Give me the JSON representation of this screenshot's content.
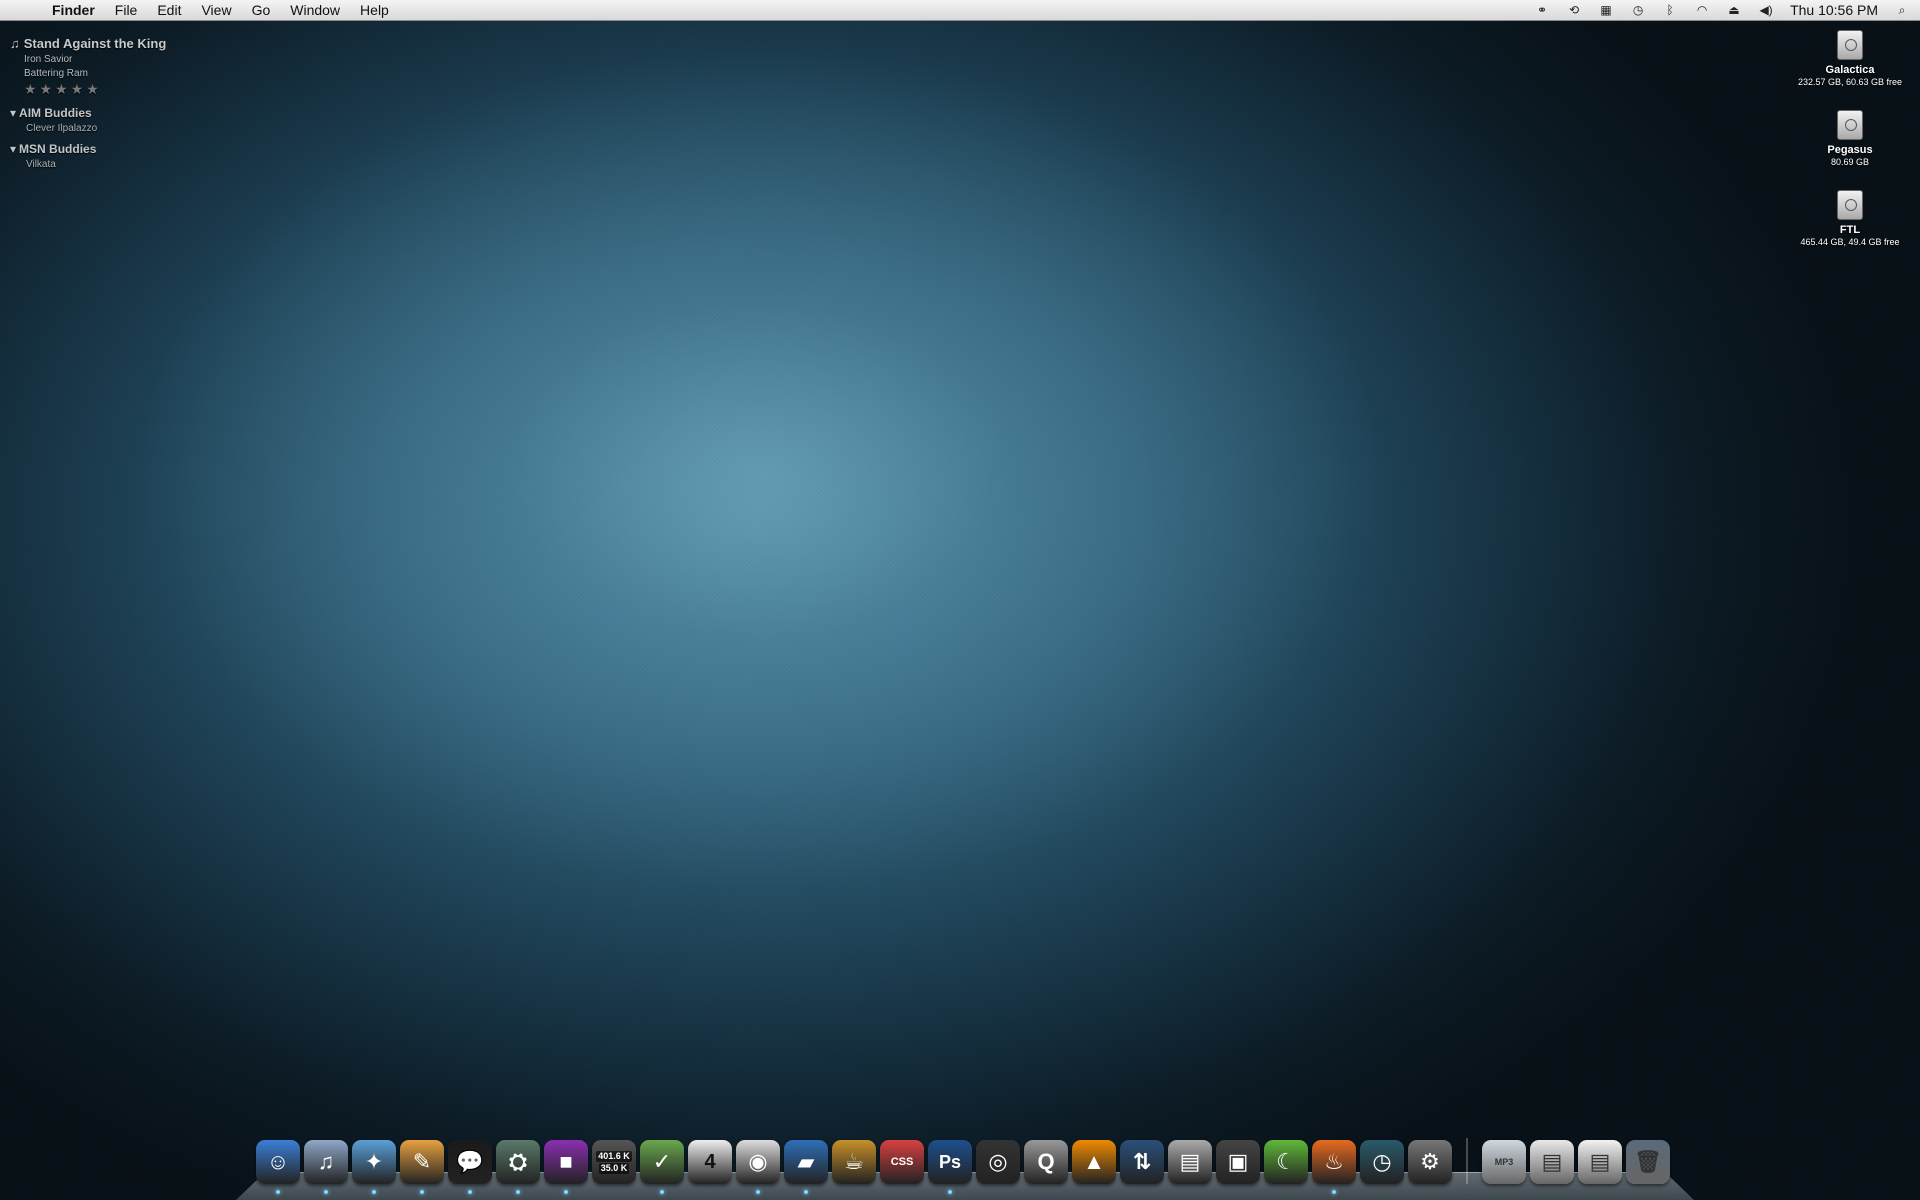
{
  "menubar": {
    "apple": "",
    "app_name": "Finder",
    "menus": [
      "File",
      "Edit",
      "View",
      "Go",
      "Window",
      "Help"
    ],
    "status_icons": [
      "binoculars-icon",
      "sync-icon",
      "spaces-icon",
      "time-machine-icon",
      "bluetooth-icon",
      "wifi-icon",
      "eject-icon",
      "volume-icon"
    ],
    "clock": "Thu 10:56 PM",
    "spotlight": "⌕"
  },
  "now_playing": {
    "title": "Stand Against the King",
    "artist": "Iron Savior",
    "album": "Battering Ram",
    "rating": "★★★★★",
    "rating_value": 0
  },
  "buddies": [
    {
      "group": "AIM Buddies",
      "members": [
        "Clever Ilpalazzo"
      ]
    },
    {
      "group": "MSN Buddies",
      "members": [
        "Vilkata"
      ]
    }
  ],
  "drives": [
    {
      "name": "Galactica",
      "info": "232.57 GB, 60.63 GB free"
    },
    {
      "name": "Pegasus",
      "info": "80.69 GB"
    },
    {
      "name": "FTL",
      "info": "465.44 GB, 49.4 GB free"
    }
  ],
  "dock": {
    "network_monitor": {
      "up": "401.6 K",
      "down": "35.0 K"
    },
    "calendar_day": "4",
    "photoshop_label": "Ps",
    "css_label": "CSS",
    "doc_label": "MP3",
    "items": [
      {
        "name": "finder-icon",
        "color": "#3b7fd6",
        "running": true
      },
      {
        "name": "itunes-icon",
        "color": "#8fa8c8",
        "running": true
      },
      {
        "name": "safari-icon",
        "color": "#5aa0d8",
        "running": true
      },
      {
        "name": "notes-icon",
        "color": "#e8a040",
        "running": true
      },
      {
        "name": "chat-icon",
        "color": "#1a1a1a",
        "running": true
      },
      {
        "name": "ufo-icon",
        "color": "#5a7a6a",
        "running": true
      },
      {
        "name": "purple-app-icon",
        "color": "#8a2fb0",
        "running": true
      },
      {
        "name": "network-monitor-icon",
        "color": "#555",
        "running": false
      },
      {
        "name": "tasks-icon",
        "color": "#6aa84f",
        "running": true
      },
      {
        "name": "calendar-icon",
        "color": "#eeeeee",
        "running": false
      },
      {
        "name": "eyes-icon",
        "color": "#dddddd",
        "running": true
      },
      {
        "name": "book-icon",
        "color": "#2f6fb8",
        "running": true
      },
      {
        "name": "coffee-icon",
        "color": "#c8902a",
        "running": false
      },
      {
        "name": "css-editor-icon",
        "color": "#d84040",
        "running": false
      },
      {
        "name": "photoshop-icon",
        "color": "#1d4f8c",
        "running": true
      },
      {
        "name": "camera-icon",
        "color": "#333",
        "running": false
      },
      {
        "name": "quicktime-icon",
        "color": "#999",
        "running": false
      },
      {
        "name": "vlc-icon",
        "color": "#f08a00",
        "running": false
      },
      {
        "name": "transmit-icon",
        "color": "#2a4f7a",
        "running": false
      },
      {
        "name": "scanner-icon",
        "color": "#aaaaaa",
        "running": false
      },
      {
        "name": "truck-icon",
        "color": "#444",
        "running": false
      },
      {
        "name": "moon-icon",
        "color": "#5fb83a",
        "running": false
      },
      {
        "name": "flame-icon",
        "color": "#e86a20",
        "running": true
      },
      {
        "name": "time-machine-app-icon",
        "color": "#2a5a6a",
        "running": false
      },
      {
        "name": "system-preferences-icon",
        "color": "#777",
        "running": false
      }
    ],
    "stacks": [
      {
        "name": "downloads-stack-icon",
        "color": "#cfd8e0"
      },
      {
        "name": "documents-stack-icon",
        "color": "#e8e8e8"
      },
      {
        "name": "pdf-stack-icon",
        "color": "#f2f2f2"
      },
      {
        "name": "trash-icon",
        "color": "#5a6a7a"
      }
    ]
  }
}
